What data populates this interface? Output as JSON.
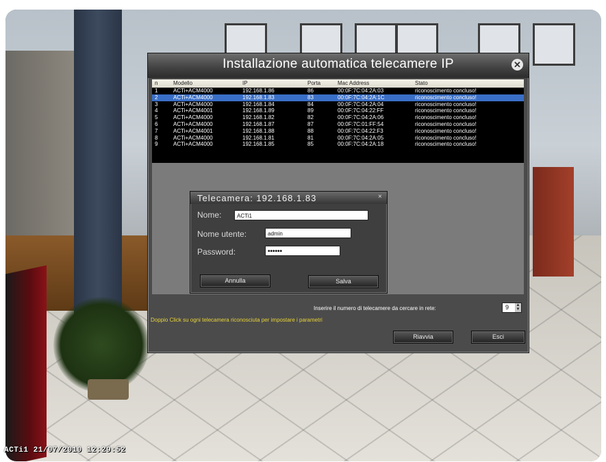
{
  "overlay": {
    "timestamp": "ACTi1 21/07/2010 12:29:52"
  },
  "dialog": {
    "title": "Installazione automatica telecamere IP",
    "table": {
      "headers": [
        "n",
        "Modello",
        "IP",
        "Porta",
        "Mac Address",
        "Stato"
      ],
      "rows": [
        [
          "1",
          "ACTi+ACM4000",
          "192.168.1.86",
          "86",
          "00:0F:7C:04:2A:03",
          "riconoscimento concluso!"
        ],
        [
          "2",
          "ACTi+ACM4000",
          "192.168.1.83",
          "83",
          "00:0F:7C:04:2A:1C",
          "riconoscimento concluso!"
        ],
        [
          "3",
          "ACTi+ACM4000",
          "192.168.1.84",
          "84",
          "00:0F:7C:04:2A:04",
          "riconoscimento concluso!"
        ],
        [
          "4",
          "ACTi+ACM4001",
          "192.168.1.89",
          "89",
          "00:0F:7C:04:22:FF",
          "riconoscimento concluso!"
        ],
        [
          "5",
          "ACTi+ACM4000",
          "192.168.1.82",
          "82",
          "00:0F:7C:04:2A:06",
          "riconoscimento concluso!"
        ],
        [
          "6",
          "ACTi+ACM4000",
          "192.168.1.87",
          "87",
          "00:0F:7C:01:FF:54",
          "riconoscimento concluso!"
        ],
        [
          "7",
          "ACTi+ACM4001",
          "192.168.1.88",
          "88",
          "00:0F:7C:04:22:F3",
          "riconoscimento concluso!"
        ],
        [
          "8",
          "ACTi+ACM4000",
          "192.168.1.81",
          "81",
          "00:0F:7C:04:2A:05",
          "riconoscimento concluso!"
        ],
        [
          "9",
          "ACTi+ACM4000",
          "192.168.1.85",
          "85",
          "00:0F:7C:04:2A:18",
          "riconoscimento concluso!"
        ]
      ],
      "selected_row": 2
    },
    "camera_count_label": "Inserire il numero di telecamere da cercare in rete:",
    "camera_count_value": "9",
    "hint": "Doppio Click su ogni telecamera riconosciuta per impostare i parametri",
    "buttons": {
      "restart": "Riavvia",
      "exit": "Esci"
    }
  },
  "camera_dialog": {
    "title": "Telecamera: 192.168.1.83",
    "close": "×",
    "name_label": "Nome:",
    "name_value": "ACTi1",
    "user_label": "Nome utente:",
    "user_value": "admin",
    "password_label": "Password:",
    "password_value": "••••••",
    "cancel": "Annulla",
    "save": "Salva"
  },
  "icons": {
    "close": "close-icon",
    "spin": "spinner-arrows-icon"
  }
}
